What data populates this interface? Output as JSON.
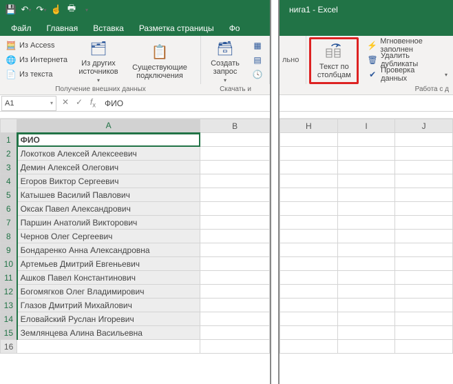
{
  "title_right": "нига1 - Excel",
  "tabs": {
    "file": "Файл",
    "home": "Главная",
    "insert": "Вставка",
    "layout": "Разметка страницы",
    "formulas": "Фо",
    "right_tail": "льно"
  },
  "ribbon": {
    "ext_group_label": "Получение внешних данных",
    "access": "Из Access",
    "internet": "Из Интернета",
    "text": "Из текста",
    "other_sources": "Из других\nисточников",
    "existing_conn": "Существующие\nподключения",
    "create_query": "Создать\nзапрос",
    "download_label": "Скачать и",
    "right": {
      "text_to_columns": "Текст по\nстолбцам",
      "flash_fill": "Мгновенное заполнен",
      "remove_dup": "Удалить дубликаты",
      "data_valid": "Проверка данных",
      "group_label": "Работа с д"
    }
  },
  "namebox": "A1",
  "formula": "ФИО",
  "columns_left": [
    "A",
    "B"
  ],
  "columns_right": [
    "H",
    "I",
    "J"
  ],
  "rows": [
    {
      "n": 1,
      "v": "ФИО",
      "bold": true,
      "active": true
    },
    {
      "n": 2,
      "v": "Локотков Алексей Алексеевич"
    },
    {
      "n": 3,
      "v": "Демин Алексей Олегович"
    },
    {
      "n": 4,
      "v": "Егоров Виктор Сергеевич"
    },
    {
      "n": 5,
      "v": "Катышев Василий Павлович"
    },
    {
      "n": 6,
      "v": "Оксак Павел Александрович"
    },
    {
      "n": 7,
      "v": "Паршин Анатолий Викторович"
    },
    {
      "n": 8,
      "v": "Чернов Олег Сергеевич"
    },
    {
      "n": 9,
      "v": "Бондаренко Анна Александровна"
    },
    {
      "n": 10,
      "v": "Артемьев Дмитрий Евгеньевич"
    },
    {
      "n": 11,
      "v": "Ашков Павел Константинович"
    },
    {
      "n": 12,
      "v": "Богомягков Олег Владимирович"
    },
    {
      "n": 13,
      "v": "Глазов Дмитрий Михайлович"
    },
    {
      "n": 14,
      "v": "Еловайский Руслан Игоревич"
    },
    {
      "n": 15,
      "v": "Землянцева Алина Васильевна"
    },
    {
      "n": 16,
      "v": ""
    }
  ]
}
